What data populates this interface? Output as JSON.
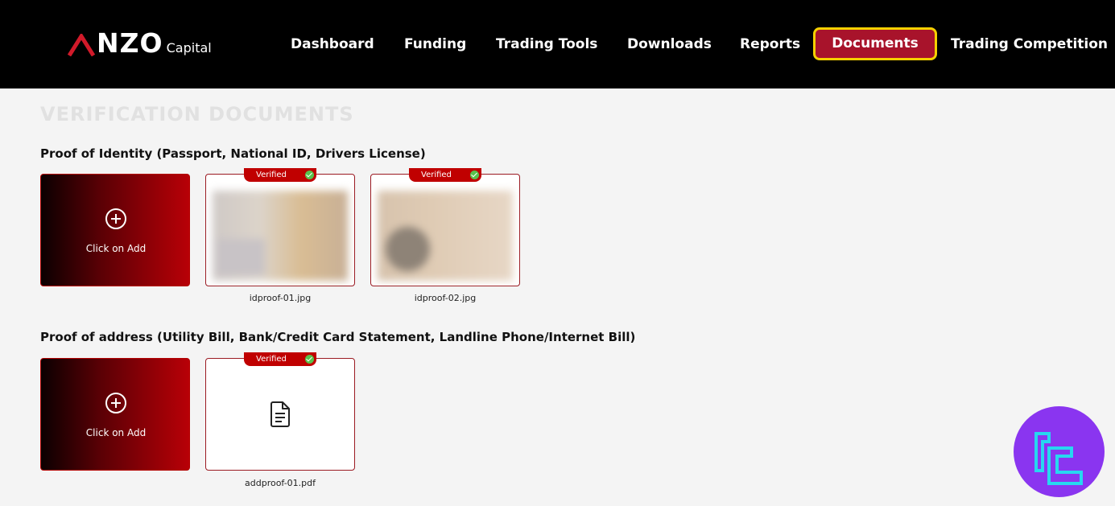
{
  "header": {
    "logo_word": "NZO",
    "logo_sub": "Capital",
    "nav": [
      {
        "label": "Dashboard"
      },
      {
        "label": "Funding"
      },
      {
        "label": "Trading Tools"
      },
      {
        "label": "Downloads"
      },
      {
        "label": "Reports"
      },
      {
        "label": "Documents",
        "active": true
      },
      {
        "label": "Trading Competition"
      }
    ]
  },
  "page": {
    "title": "VERIFICATION DOCUMENTS"
  },
  "identity": {
    "heading": "Proof of Identity (Passport, National ID, Drivers License)",
    "add_label": "Click on Add",
    "files": [
      {
        "name": "idproof-01.jpg",
        "status": "Verified"
      },
      {
        "name": "idproof-02.jpg",
        "status": "Verified"
      }
    ]
  },
  "address": {
    "heading": "Proof of address (Utility Bill, Bank/Credit Card Statement, Landline Phone/Internet Bill)",
    "add_label": "Click on Add",
    "files": [
      {
        "name": "addproof-01.pdf",
        "status": "Verified"
      }
    ]
  },
  "icons": [
    "plus-circle-icon",
    "check-icon",
    "document-icon",
    "watermark-logo-icon"
  ],
  "colors": {
    "header_bg": "#000000",
    "active_tab_bg": "#a8132b",
    "active_tab_border": "#f5d000",
    "badge_red": "#c00000",
    "verified_green": "#58c24c",
    "watermark_purple": "#8a35f0"
  }
}
